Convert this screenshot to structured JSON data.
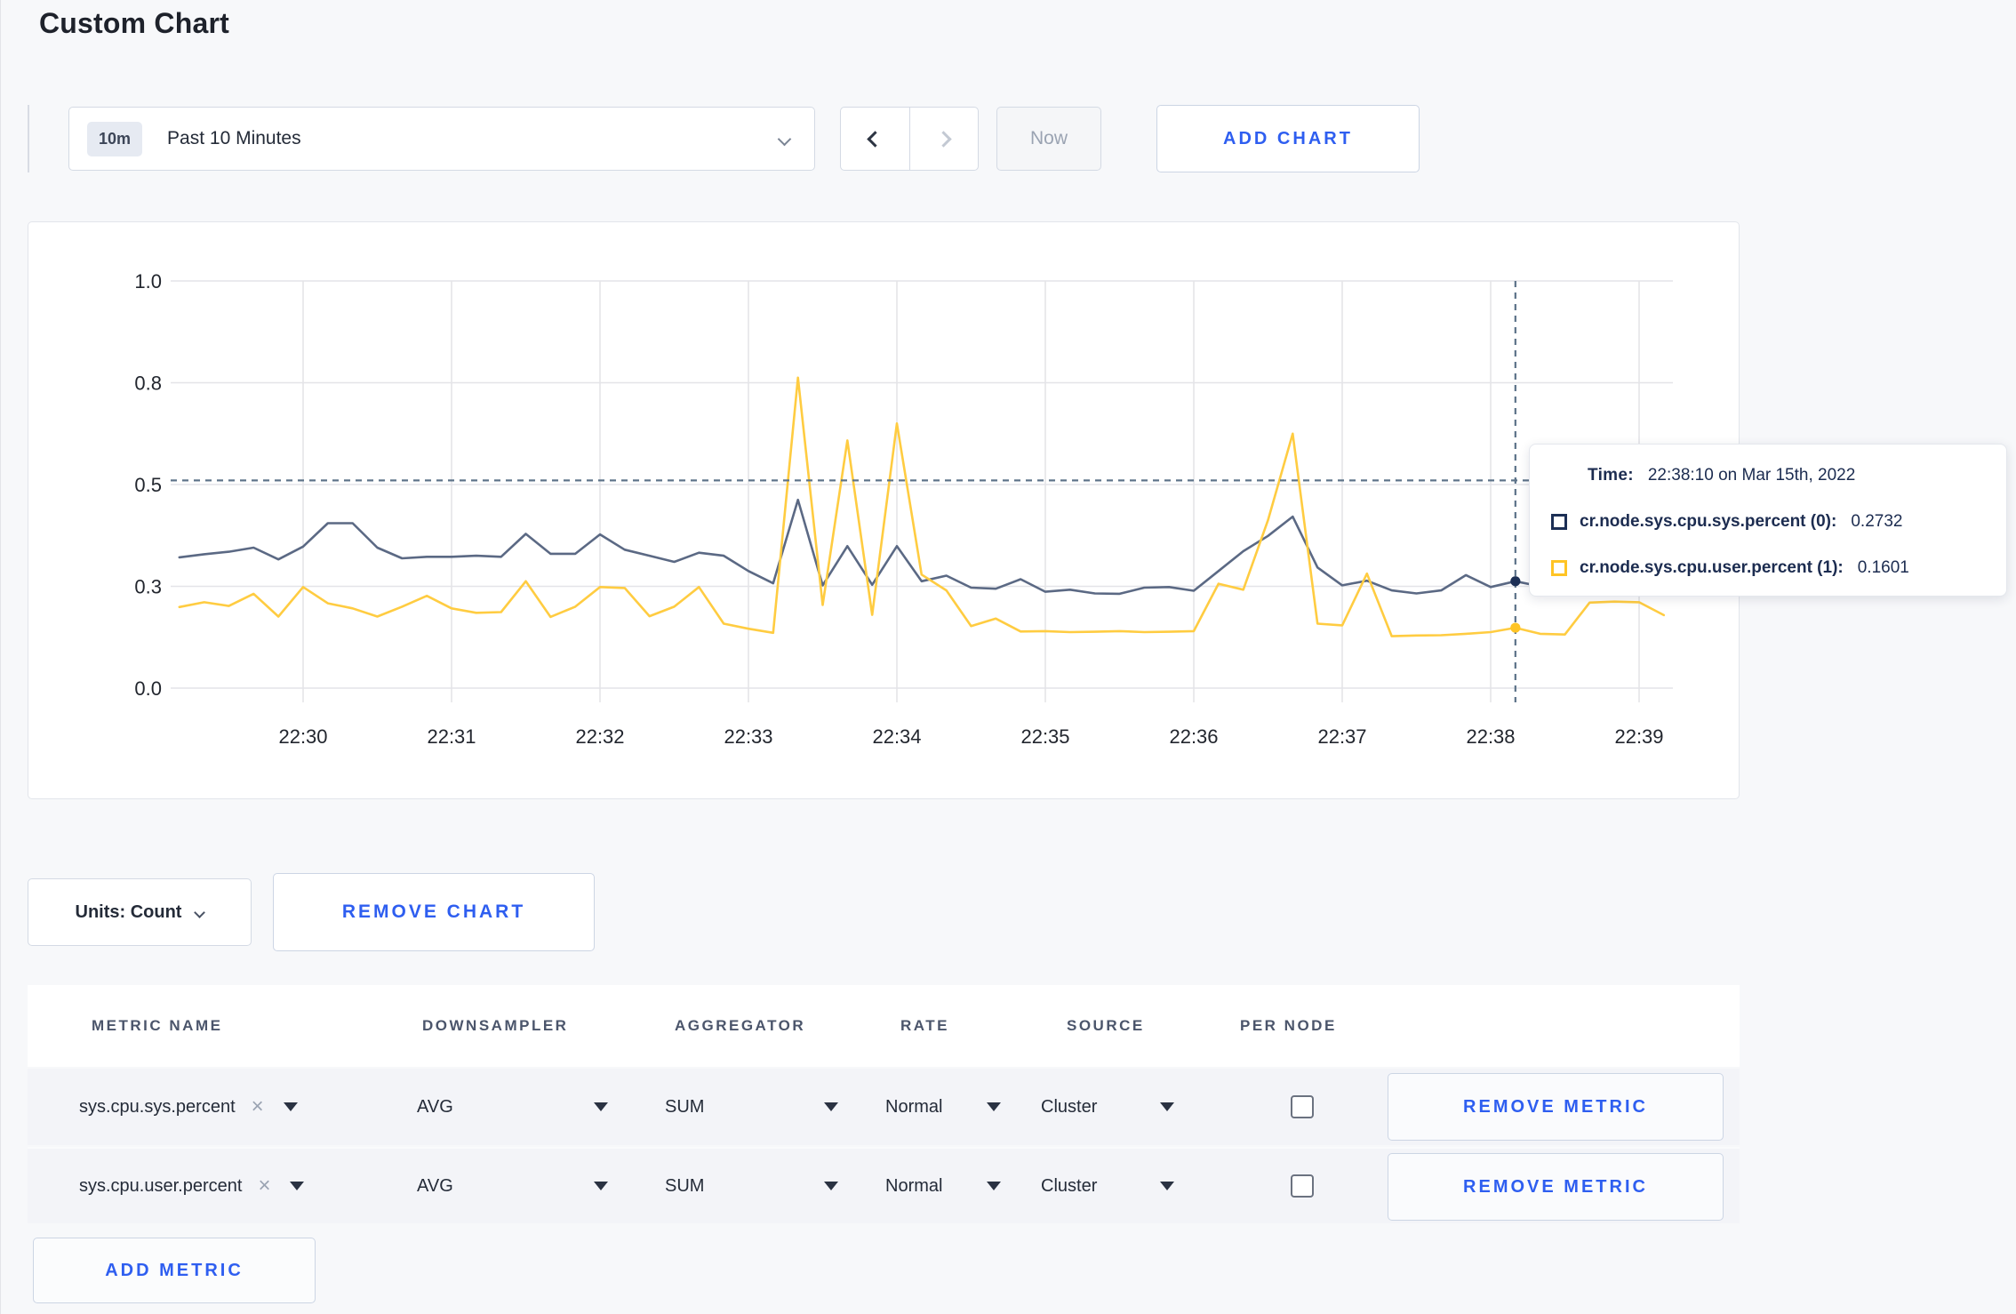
{
  "page": {
    "title": "Custom Chart"
  },
  "toolbar": {
    "time_window_badge": "10m",
    "time_window_label": "Past 10 Minutes",
    "now_label": "Now",
    "add_chart_label": "ADD CHART"
  },
  "chart_controls": {
    "units_label": "Units: Count",
    "remove_chart_label": "REMOVE CHART"
  },
  "chart_data": {
    "type": "line",
    "x_axis": {
      "labels": [
        "22:30",
        "22:31",
        "22:32",
        "22:33",
        "22:34",
        "22:35",
        "22:36",
        "22:37",
        "22:38",
        "22:39"
      ]
    },
    "y_axis": {
      "labels": [
        "1.0",
        "0.8",
        "0.5",
        "0.3",
        "0.0"
      ],
      "tick_values": [
        1.0,
        0.8,
        0.5,
        0.3,
        0.0
      ]
    },
    "x_times": [
      "22:29:10",
      "22:29:20",
      "22:29:30",
      "22:29:40",
      "22:29:50",
      "22:30:00",
      "22:30:10",
      "22:30:20",
      "22:30:30",
      "22:30:40",
      "22:30:50",
      "22:31:00",
      "22:31:10",
      "22:31:20",
      "22:31:30",
      "22:31:40",
      "22:31:50",
      "22:32:00",
      "22:32:10",
      "22:32:20",
      "22:32:30",
      "22:32:40",
      "22:32:50",
      "22:33:00",
      "22:33:10",
      "22:33:20",
      "22:33:30",
      "22:33:40",
      "22:33:50",
      "22:34:00",
      "22:34:10",
      "22:34:20",
      "22:34:30",
      "22:34:40",
      "22:34:50",
      "22:35:00",
      "22:35:10",
      "22:35:20",
      "22:35:30",
      "22:35:40",
      "22:35:50",
      "22:36:00",
      "22:36:10",
      "22:36:20",
      "22:36:30",
      "22:36:40",
      "22:36:50",
      "22:37:00",
      "22:37:10",
      "22:37:20",
      "22:37:30",
      "22:37:40",
      "22:37:50",
      "22:38:00",
      "22:38:10",
      "22:38:20",
      "22:38:30",
      "22:38:40",
      "22:38:50",
      "22:39:00",
      "22:39:10"
    ],
    "series": [
      {
        "name": "cr.node.sys.cpu.sys.percent (0)",
        "color": "#5b6984",
        "values": [
          0.357,
          0.363,
          0.368,
          0.376,
          0.353,
          0.378,
          0.424,
          0.424,
          0.376,
          0.355,
          0.358,
          0.358,
          0.36,
          0.358,
          0.403,
          0.364,
          0.364,
          0.402,
          0.372,
          0.36,
          0.348,
          0.366,
          0.36,
          0.33,
          0.306,
          0.47,
          0.302,
          0.379,
          0.303,
          0.379,
          0.31,
          0.321,
          0.296,
          0.293,
          0.314,
          0.284,
          0.29,
          0.279,
          0.278,
          0.296,
          0.298,
          0.287,
          0.33,
          0.369,
          0.399,
          0.437,
          0.337,
          0.302,
          0.311,
          0.288,
          0.279,
          0.288,
          0.322,
          0.298,
          0.31,
          0.3,
          0.302,
          0.3,
          0.298,
          0.302,
          0.31
        ]
      },
      {
        "name": "cr.node.sys.cpu.user.percent (1)",
        "color": "#ffcc41",
        "values": [
          0.239,
          0.253,
          0.242,
          0.278,
          0.211,
          0.298,
          0.25,
          0.235,
          0.211,
          0.24,
          0.272,
          0.235,
          0.222,
          0.224,
          0.31,
          0.21,
          0.24,
          0.298,
          0.295,
          0.212,
          0.24,
          0.298,
          0.19,
          0.175,
          0.163,
          0.81,
          0.245,
          0.63,
          0.216,
          0.68,
          0.323,
          0.288,
          0.183,
          0.205,
          0.167,
          0.168,
          0.165,
          0.166,
          0.168,
          0.165,
          0.166,
          0.168,
          0.305,
          0.29,
          0.43,
          0.65,
          0.19,
          0.185,
          0.325,
          0.153,
          0.155,
          0.156,
          0.16,
          0.165,
          0.178,
          0.16,
          0.158,
          0.252,
          0.255,
          0.253,
          0.215
        ]
      }
    ],
    "crosshair": {
      "time": "22:38:10",
      "hover_line_value": 0.512,
      "markers": [
        {
          "series": 0,
          "value": 0.31
        },
        {
          "series": 1,
          "value": 0.178
        }
      ]
    },
    "tooltip": {
      "time_label": "Time:",
      "time_value": "22:38:10 on Mar 15th, 2022",
      "entries": [
        {
          "label": "cr.node.sys.cpu.sys.percent (0):",
          "value": "0.2732",
          "swatch_color": "#1c2f55"
        },
        {
          "label": "cr.node.sys.cpu.user.percent (1):",
          "value": "0.1601",
          "swatch_color": "#ffc425"
        }
      ]
    }
  },
  "metrics_table": {
    "columns": [
      "METRIC NAME",
      "DOWNSAMPLER",
      "AGGREGATOR",
      "RATE",
      "SOURCE",
      "PER NODE"
    ],
    "remove_icon": "×",
    "rows": [
      {
        "metric": "sys.cpu.sys.percent",
        "downsampler": "AVG",
        "aggregator": "SUM",
        "rate": "Normal",
        "source": "Cluster",
        "per_node_checked": false,
        "remove_metric_label": "REMOVE METRIC"
      },
      {
        "metric": "sys.cpu.user.percent",
        "downsampler": "AVG",
        "aggregator": "SUM",
        "rate": "Normal",
        "source": "Cluster",
        "per_node_checked": false,
        "remove_metric_label": "REMOVE METRIC"
      }
    ],
    "add_metric_label": "ADD METRIC"
  }
}
